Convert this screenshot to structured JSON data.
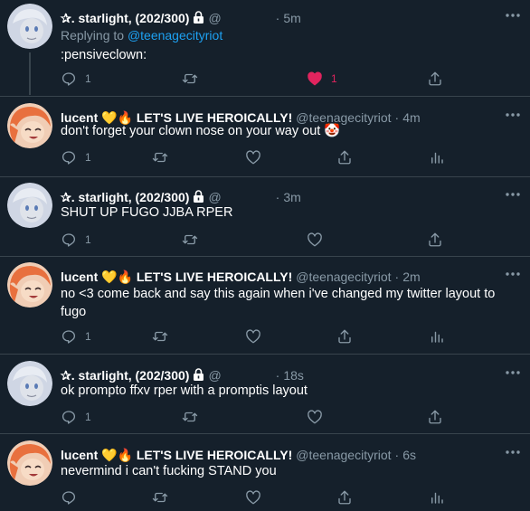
{
  "tweets": [
    {
      "author": "starlight",
      "display_name": "✰. starlight, (202/300)",
      "handle": "@",
      "time": "5m",
      "reply_prefix": "Replying to ",
      "reply_handle": "@teenagecityriot",
      "text": ":pensiveclown:",
      "reply_count": "1",
      "retweet_count": "",
      "like_count": "1",
      "liked": true,
      "has_analytics": false
    },
    {
      "author": "lucent",
      "display_name": "lucent 💛🔥 LET'S LIVE HEROICALLY!",
      "handle": "@teenagecityriot",
      "time": "4m",
      "text": "don't forget your clown nose on your way out 🤡",
      "reply_count": "1",
      "retweet_count": "",
      "like_count": "",
      "liked": false,
      "has_analytics": true
    },
    {
      "author": "starlight",
      "display_name": "✰. starlight, (202/300)",
      "handle": "@",
      "time": "3m",
      "text": "SHUT UP FUGO JJBA RPER",
      "reply_count": "1",
      "retweet_count": "",
      "like_count": "",
      "liked": false,
      "has_analytics": false
    },
    {
      "author": "lucent",
      "display_name": "lucent 💛🔥 LET'S LIVE HEROICALLY!",
      "handle": "@teenagecityriot",
      "time": "2m",
      "text": "no <3 come back and say this again when i've changed my twitter layout to fugo",
      "reply_count": "1",
      "retweet_count": "",
      "like_count": "",
      "liked": false,
      "has_analytics": true
    },
    {
      "author": "starlight",
      "display_name": "✰. starlight, (202/300)",
      "handle": "@",
      "time": "18s",
      "text": "ok prompto ffxv rper with a promptis layout",
      "reply_count": "1",
      "retweet_count": "",
      "like_count": "",
      "liked": false,
      "has_analytics": false
    },
    {
      "author": "lucent",
      "display_name": "lucent 💛🔥 LET'S LIVE HEROICALLY!",
      "handle": "@teenagecityriot",
      "time": "6s",
      "text": "nevermind i can't fucking STAND you",
      "reply_count": "",
      "retweet_count": "",
      "like_count": "",
      "liked": false,
      "has_analytics": true
    }
  ],
  "colors": {
    "background": "#15202b",
    "muted": "#8899a6",
    "link": "#1da1f2",
    "like": "#e0245e",
    "line": "#38444d"
  },
  "icons": [
    "reply-icon",
    "retweet-icon",
    "like-icon",
    "share-icon",
    "analytics-icon",
    "more-icon",
    "lock-icon"
  ]
}
